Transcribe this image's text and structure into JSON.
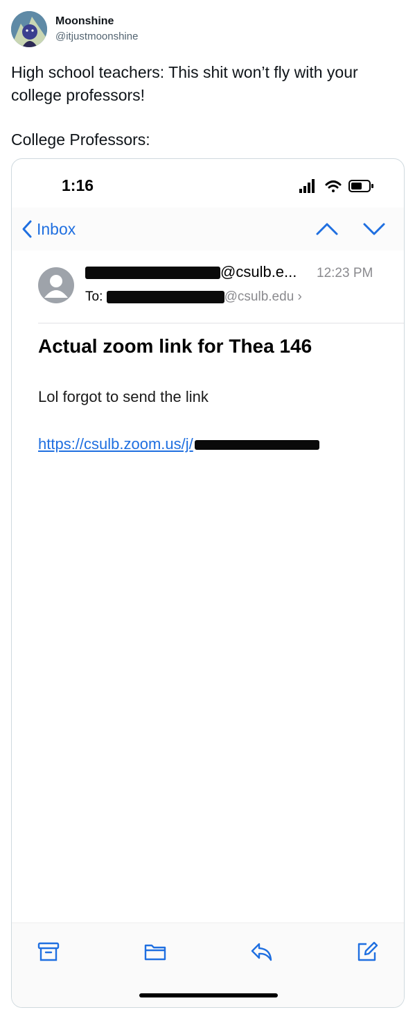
{
  "tweet": {
    "display_name": "Moonshine",
    "handle": "@itjustmoonshine",
    "text_line1": "High school teachers: This shit won’t fly with your college professors!",
    "text_line2": "College Professors:"
  },
  "phone": {
    "status_time": "1:16",
    "nav": {
      "back_label": "Inbox"
    },
    "email": {
      "sender_visible": "@csulb.e...",
      "time": "12:23 PM",
      "to_label": "To:",
      "to_visible": "@csulb.edu",
      "subject": "Actual zoom link for Thea 146",
      "body": "Lol forgot to send the link",
      "link_visible": "https://csulb.zoom.us/j/"
    }
  },
  "colors": {
    "ios_blue": "#1f6fe0",
    "twitter_secondary": "#536471",
    "border": "#cfd9de"
  },
  "icons": [
    "back-chevron-icon",
    "up-arrow-icon",
    "down-arrow-icon",
    "signal-icon",
    "wifi-icon",
    "battery-icon",
    "archive-icon",
    "folder-icon",
    "reply-icon",
    "compose-icon"
  ]
}
